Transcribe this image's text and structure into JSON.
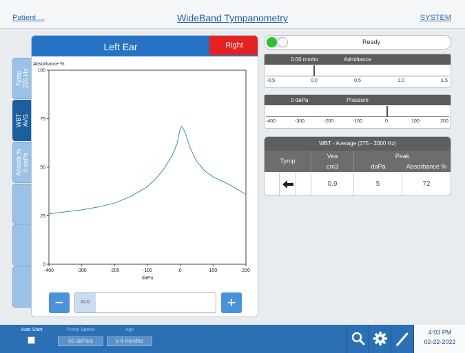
{
  "header": {
    "patient_link": "Patient ...",
    "title": "WideBand Tympanometry",
    "system_link": "SYSTEM"
  },
  "side_tabs": [
    {
      "label_line1": "Tymp",
      "label_line2": "226 Hz",
      "active": false
    },
    {
      "label_line1": "WBT",
      "label_line2": "AVG",
      "active": true
    },
    {
      "label_line1": "Absorb %",
      "label_line2": "0 daPa",
      "active": false
    },
    {
      "label_line1": "",
      "label_line2": "",
      "active": false
    },
    {
      "label_line1": "",
      "label_line2": "",
      "active": false
    },
    {
      "label_line1": "",
      "label_line2": "",
      "active": false
    }
  ],
  "ear_panel": {
    "active_ear": "Left Ear",
    "other_ear_tab": "Right",
    "left_color": "#2672c4",
    "right_color": "#e52222"
  },
  "chart_data": {
    "type": "line",
    "ylabel": "Absorbance %",
    "xlabel": "daPa",
    "xlim": [
      -400,
      200
    ],
    "ylim": [
      0,
      100
    ],
    "x_ticks": [
      -400,
      -300,
      -200,
      -100,
      0,
      100,
      200
    ],
    "y_ticks": [
      0,
      25,
      50,
      75,
      100
    ],
    "line_color": "#3d8ea0",
    "series": [
      {
        "x": [
          -400,
          -350,
          -300,
          -250,
          -200,
          -150,
          -100,
          -75,
          -50,
          -25,
          -10,
          0,
          5,
          15,
          30,
          50,
          75,
          100,
          150,
          200
        ],
        "y": [
          26,
          27,
          28,
          29.5,
          31.5,
          35,
          40,
          44,
          49,
          56,
          62,
          70,
          71,
          68,
          60,
          53,
          48,
          45,
          41,
          36
        ]
      }
    ]
  },
  "slider": {
    "thumb_label": "AVG",
    "minus_label": "−",
    "plus_label": "+"
  },
  "status": {
    "text": "Ready",
    "indicator_color": "#2fbf2f"
  },
  "admittance": {
    "value": "0.00 mmho",
    "name": "Admittance",
    "ticks": [
      "-0.5",
      "0.0",
      "0.5",
      "1.0",
      "1.5"
    ]
  },
  "pressure": {
    "value": "0 daPa",
    "name": "Pressure",
    "ticks": [
      "-400",
      "-300",
      "-200",
      "-100",
      "0",
      "100",
      "200"
    ]
  },
  "wbt_table": {
    "title": "WBT - Average (375 - 2000 Hz)",
    "col_tymp": "Tymp",
    "col_vea": "Vea",
    "col_peak": "Peak",
    "unit_vea": "cm3",
    "unit_dapa": "daPa",
    "unit_absorbance": "Absorbance %",
    "row": {
      "tymp_icon": "left-arrow-icon",
      "vea": "0.9",
      "peak_dapa": "5",
      "peak_absorbance": "72"
    }
  },
  "bottom_bar": {
    "auto_start_label": "Auto Start",
    "pump_speed_label": "Pump Speed",
    "pump_speed_value": "50 daPa/s",
    "age_label": "Age",
    "age_value": "≥ 6 months",
    "time": "4:03 PM",
    "date": "02-22-2022",
    "icons": [
      "search-icon",
      "gear-icon",
      "pencil-icon"
    ]
  }
}
